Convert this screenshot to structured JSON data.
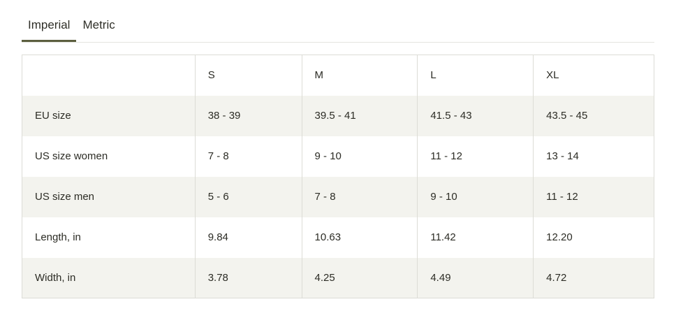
{
  "tabs": [
    {
      "label": "Imperial",
      "active": true
    },
    {
      "label": "Metric",
      "active": false
    }
  ],
  "table": {
    "columns": [
      "",
      "S",
      "M",
      "L",
      "XL"
    ],
    "rows": [
      {
        "label": "EU size",
        "values": [
          "38 - 39",
          "39.5 - 41",
          "41.5 - 43",
          "43.5 - 45"
        ]
      },
      {
        "label": "US size women",
        "values": [
          "7 - 8",
          "9 - 10",
          "11 - 12",
          "13 - 14"
        ]
      },
      {
        "label": "US size men",
        "values": [
          "5 - 6",
          "7 - 8",
          "9 - 10",
          "11 - 12"
        ]
      },
      {
        "label": "Length, in",
        "values": [
          "9.84",
          "10.63",
          "11.42",
          "12.20"
        ]
      },
      {
        "label": "Width, in",
        "values": [
          "3.78",
          "4.25",
          "4.49",
          "4.72"
        ]
      }
    ]
  },
  "colors": {
    "accent": "#5c5f3f",
    "row_shade": "#f3f3ee",
    "border": "#dcdcd6"
  }
}
